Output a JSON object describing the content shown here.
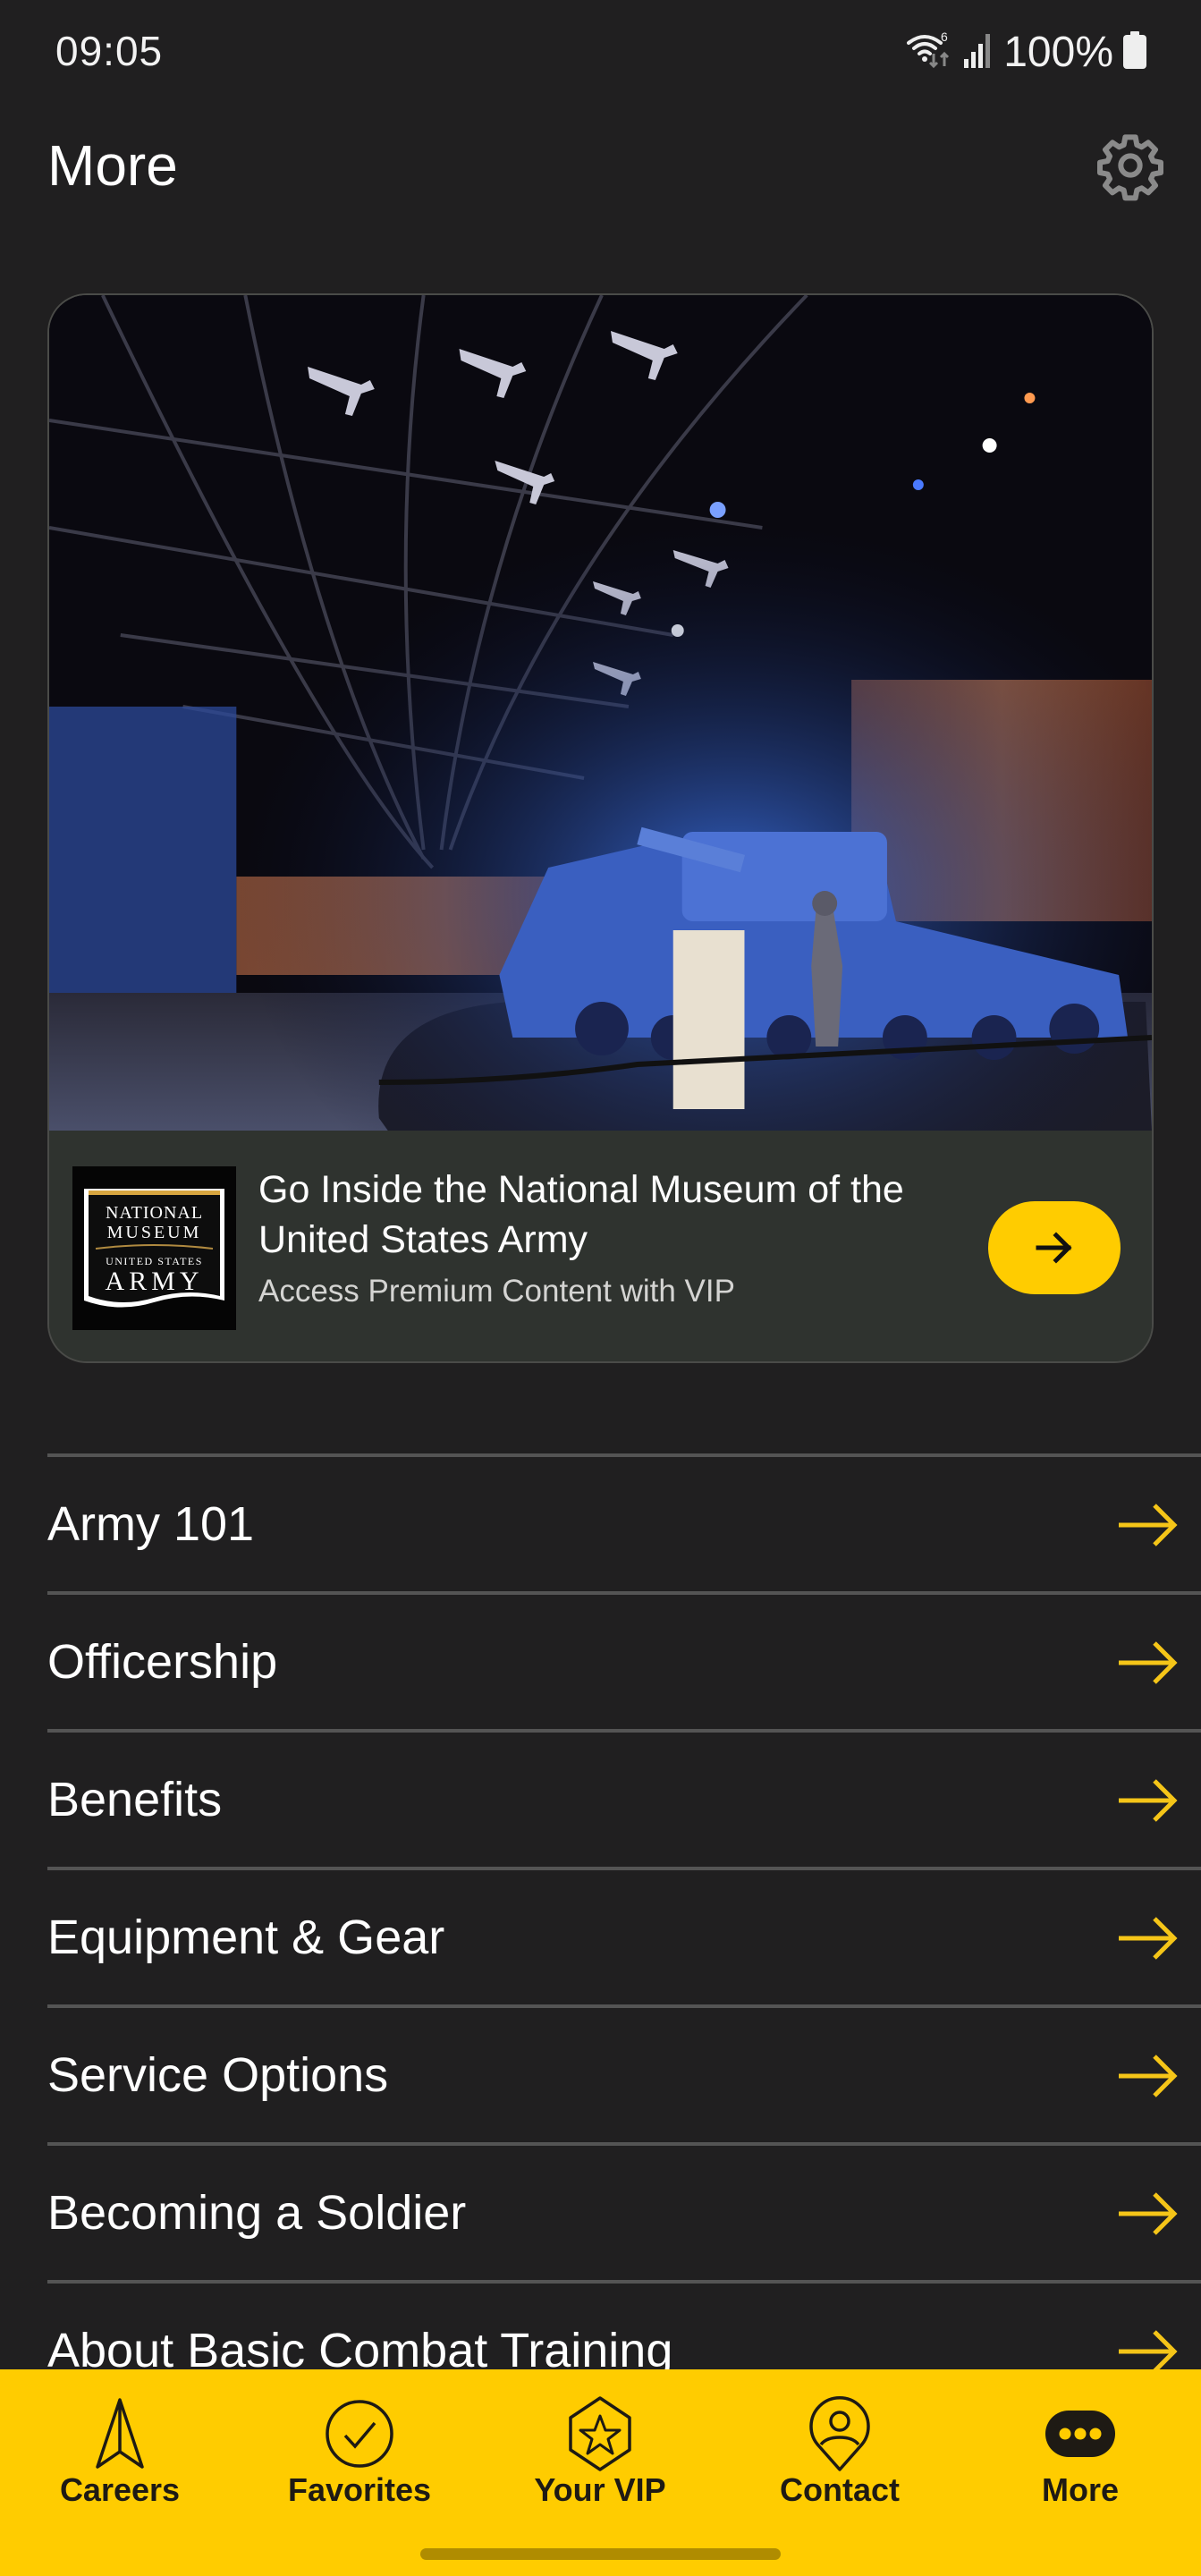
{
  "status_bar": {
    "time": "09:05",
    "battery_text": "100%",
    "icons": [
      "wifi-6-icon",
      "signal-icon",
      "battery-icon"
    ]
  },
  "header": {
    "title": "More",
    "settings_icon": "gear-icon"
  },
  "promo_card": {
    "image_description": "National Museum of the United States Army exhibit hall with Sherman tank and suspended aircraft",
    "logo_lines": [
      "NATIONAL",
      "MUSEUM",
      "UNITED STATES",
      "ARMY"
    ],
    "title": "Go Inside the National Museum of the United States Army",
    "subtitle": "Access Premium Content with VIP",
    "action_icon": "arrow-right-icon"
  },
  "menu": {
    "items": [
      {
        "label": "Army 101"
      },
      {
        "label": "Officership"
      },
      {
        "label": "Benefits"
      },
      {
        "label": "Equipment & Gear"
      },
      {
        "label": "Service Options"
      },
      {
        "label": "Becoming a Soldier"
      },
      {
        "label": "About Basic Combat Training"
      }
    ]
  },
  "bottom_nav": {
    "items": [
      {
        "label": "Careers",
        "icon": "navigation-arrow-icon"
      },
      {
        "label": "Favorites",
        "icon": "check-circle-icon"
      },
      {
        "label": "Your VIP",
        "icon": "star-badge-icon"
      },
      {
        "label": "Contact",
        "icon": "location-person-icon"
      },
      {
        "label": "More",
        "icon": "more-dots-icon",
        "active": true
      }
    ]
  },
  "colors": {
    "background": "#201f20",
    "accent": "#ffcc00",
    "arrow": "#f5c518",
    "card_footer": "#2f332f",
    "divider": "#545454"
  }
}
